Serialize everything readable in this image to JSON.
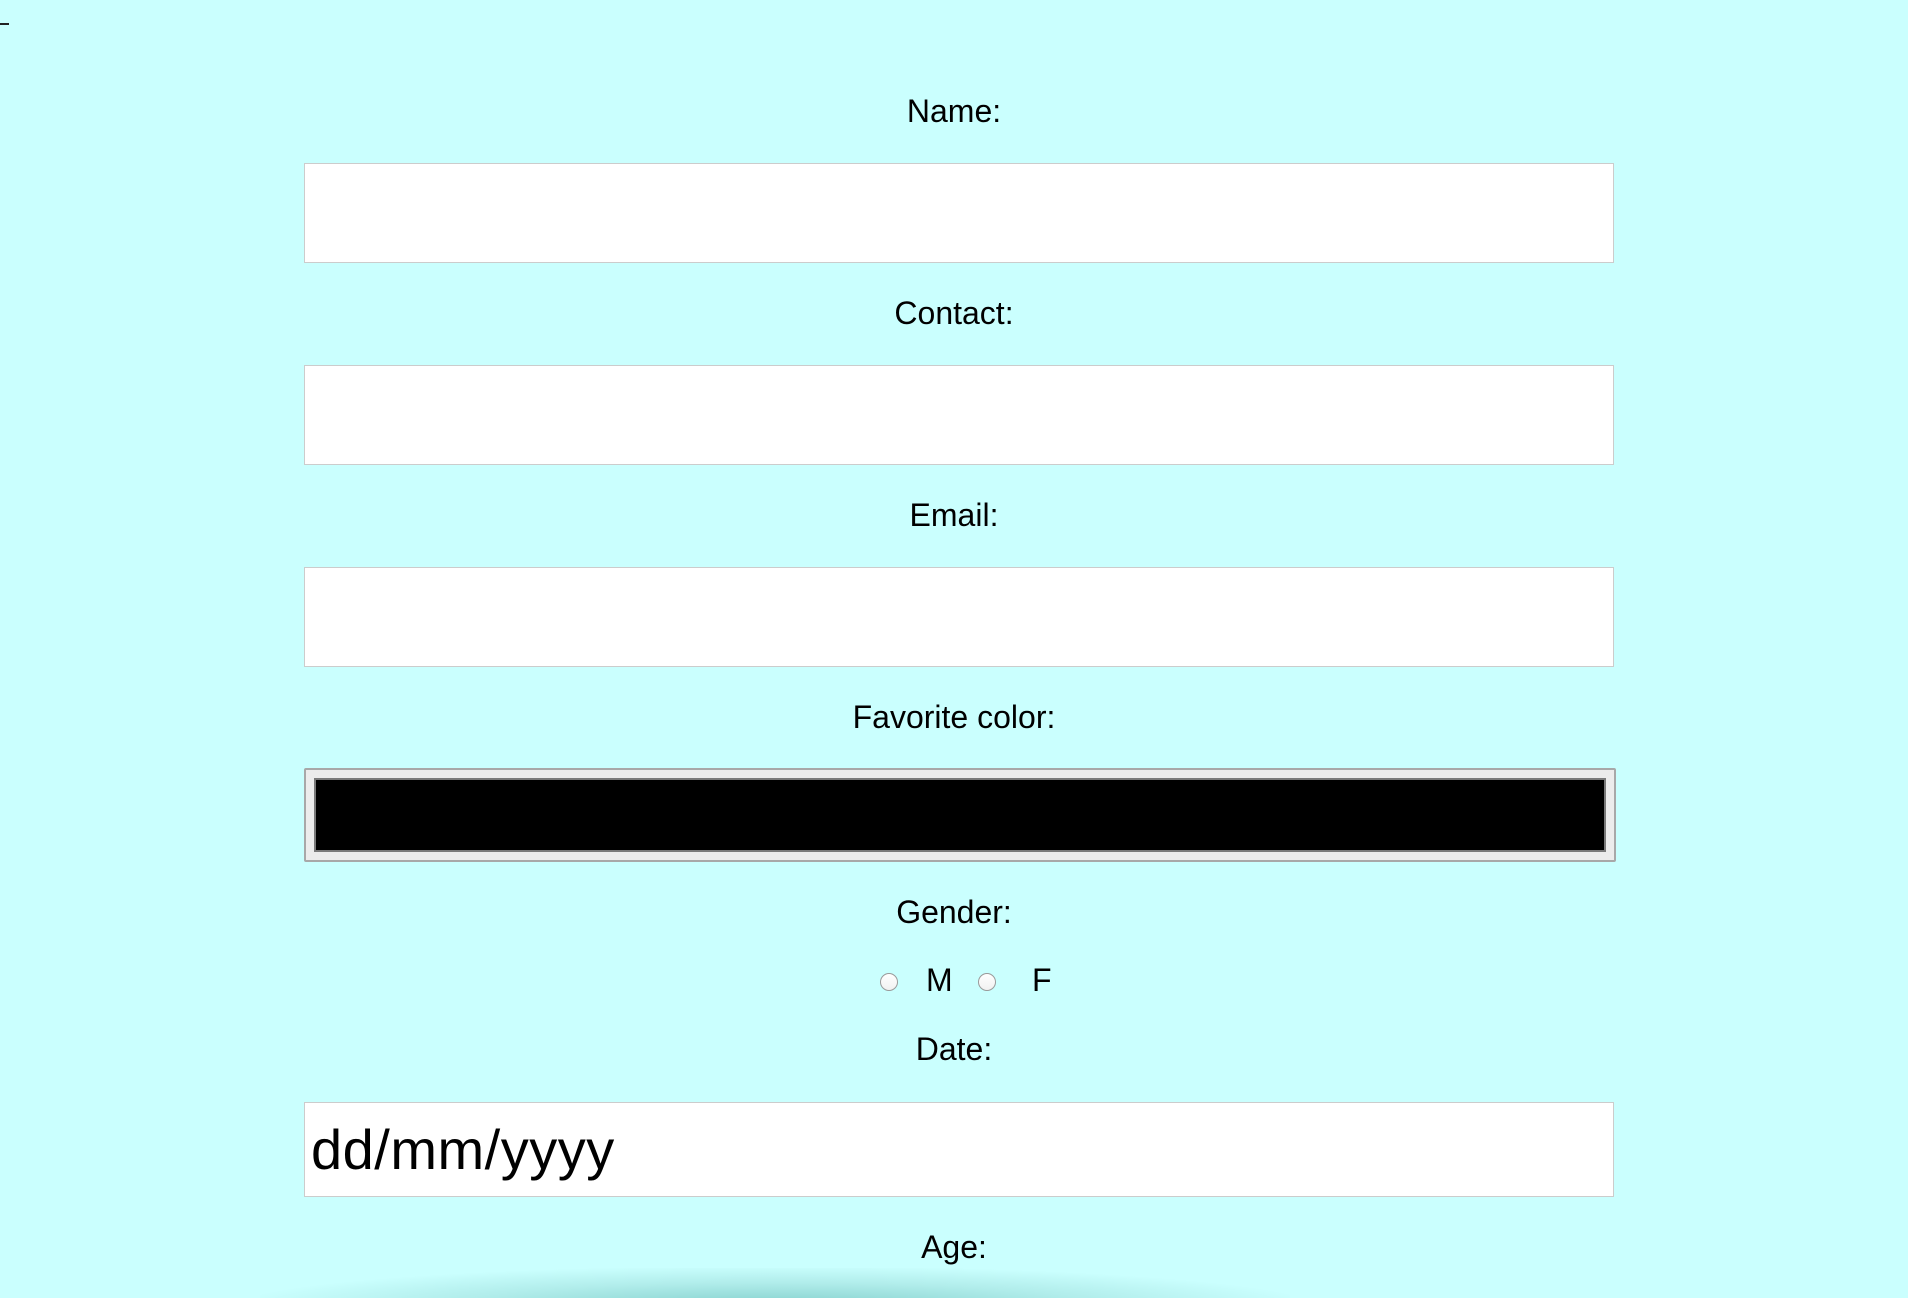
{
  "form": {
    "name": {
      "label": "Name:",
      "value": "",
      "placeholder": ""
    },
    "contact": {
      "label": "Contact:",
      "value": "",
      "placeholder": ""
    },
    "email": {
      "label": "Email:",
      "value": "",
      "placeholder": ""
    },
    "favorite_color": {
      "label": "Favorite color:",
      "value": "#000000"
    },
    "gender": {
      "label": "Gender:",
      "options": [
        {
          "label": "M",
          "checked": false
        },
        {
          "label": "F",
          "checked": false
        }
      ]
    },
    "date": {
      "label": "Date:",
      "placeholder": "dd/mm/yyyy"
    },
    "age": {
      "label": "Age:"
    }
  },
  "colors": {
    "page_background": "#cafffe",
    "input_background": "#ffffff",
    "input_border": "#cccccc"
  }
}
